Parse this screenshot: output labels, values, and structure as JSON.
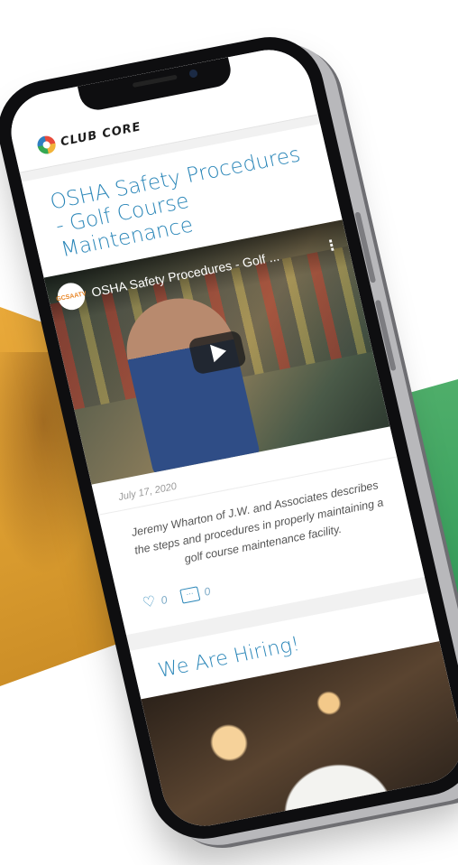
{
  "app": {
    "logo_text": "CLUB CORE"
  },
  "posts": [
    {
      "title": "OSHA Safety Procedures - Golf Course Maintenance",
      "video": {
        "channel_badge": "GCSAATV",
        "title": "OSHA Safety Procedures - Golf ..."
      },
      "date": "July 17, 2020",
      "description": "Jeremy Wharton of J.W. and Associates describes the steps and procedures in properly maintaining a golf course maintenance facility.",
      "likes": "0",
      "comments": "0"
    },
    {
      "title": "We Are Hiring!"
    }
  ],
  "colors": {
    "accent": "#2a86b8",
    "left_panel": "#e1a237",
    "right_panel": "#3ea563"
  },
  "icons": {
    "like": "heart-icon",
    "comment": "comment-icon",
    "video_menu": "kebab-icon",
    "video_play": "play-icon"
  }
}
